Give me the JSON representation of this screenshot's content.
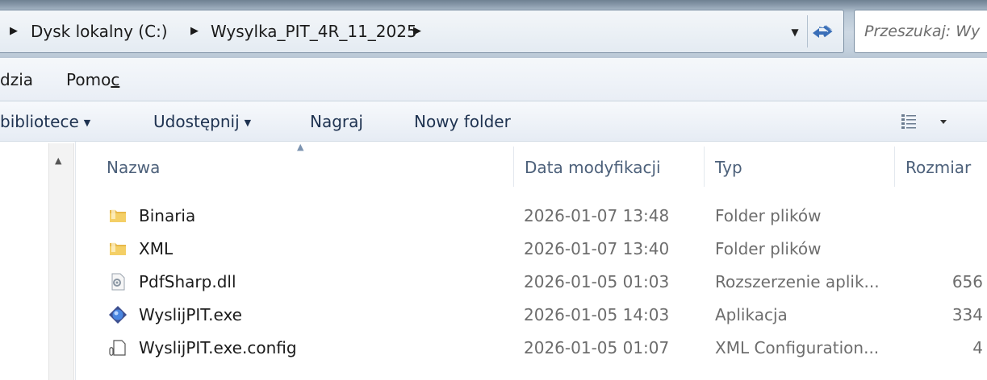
{
  "address_bar": {
    "breadcrumbs": [
      "Dysk lokalny (C:)",
      "Wysylka_PIT_4R_11_2025"
    ],
    "search_placeholder": "Przeszukaj: Wy"
  },
  "menu": {
    "items": [
      "dzia",
      "Pomoc"
    ]
  },
  "toolbar": {
    "library_label": "bibliotece",
    "share_label": "Udostępnij",
    "burn_label": "Nagraj",
    "new_folder_label": "Nowy folder"
  },
  "columns": {
    "name": "Nazwa",
    "date": "Data modyfikacji",
    "type": "Typ",
    "size": "Rozmiar"
  },
  "files": [
    {
      "name": "Binaria",
      "date": "2026-01-07 13:48",
      "type": "Folder plików",
      "size": "",
      "icon": "folder-icon"
    },
    {
      "name": "XML",
      "date": "2026-01-07 13:40",
      "type": "Folder plików",
      "size": "",
      "icon": "folder-icon"
    },
    {
      "name": "PdfSharp.dll",
      "date": "2026-01-05 01:03",
      "type": "Rozszerzenie aplik...",
      "size": "656",
      "icon": "dll-icon"
    },
    {
      "name": "WyslijPIT.exe",
      "date": "2026-01-05 14:03",
      "type": "Aplikacja",
      "size": "334",
      "icon": "application-icon"
    },
    {
      "name": "WyslijPIT.exe.config",
      "date": "2026-01-05 01:07",
      "type": "XML Configuration...",
      "size": "4",
      "icon": "config-file-icon"
    }
  ]
}
